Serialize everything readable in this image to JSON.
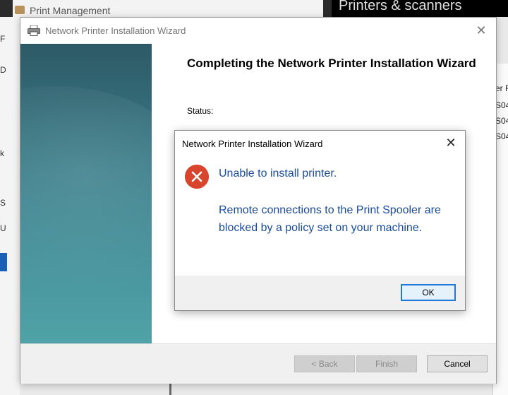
{
  "background": {
    "print_management_title": "Print Management",
    "printers_scanners_title": "Printers & scanners",
    "left_letters": [
      "F",
      "D",
      "S",
      "k",
      "U"
    ],
    "right_column": [
      "er F",
      "S04",
      "S04",
      "S04"
    ]
  },
  "wizard": {
    "title": "Network Printer Installation Wizard",
    "heading": "Completing the Network Printer Installation Wizard",
    "status_label": "Status:",
    "buttons": {
      "back": "< Back",
      "finish": "Finish",
      "cancel": "Cancel"
    }
  },
  "dialog": {
    "title": "Network Printer Installation Wizard",
    "message_primary": "Unable to install printer.",
    "message_secondary": "Remote connections to the Print Spooler are blocked by a policy set on your machine.",
    "ok_label": "OK",
    "icon": "error-icon"
  },
  "colors": {
    "error_red": "#d9442c",
    "message_blue": "#1a4b9b",
    "ok_border": "#1e78d7",
    "banner_teal": "#3a7f8b"
  }
}
